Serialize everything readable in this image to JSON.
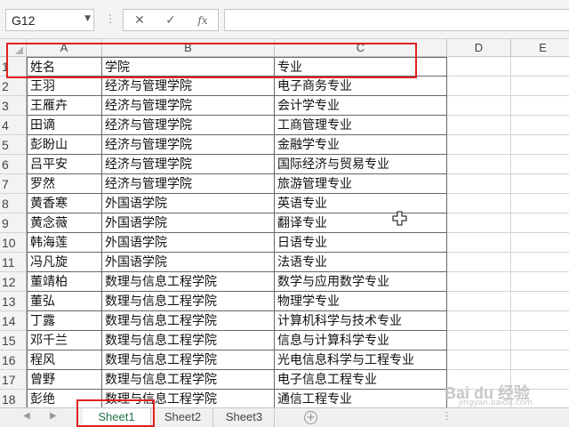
{
  "formula_bar": {
    "name_box": "G12",
    "name_box_arrow_icon": "chevron-down-icon",
    "separator": "⋮",
    "cancel_icon": "close-icon",
    "confirm_icon": "check-icon",
    "function_label": "fx",
    "formula_value": ""
  },
  "columns": [
    "A",
    "B",
    "C",
    "D",
    "E"
  ],
  "rows": [
    {
      "num": "1",
      "cells": [
        "姓名",
        "学院",
        "专业"
      ]
    },
    {
      "num": "2",
      "cells": [
        "王羽",
        "经济与管理学院",
        "电子商务专业"
      ]
    },
    {
      "num": "3",
      "cells": [
        "王雁卉",
        "经济与管理学院",
        "会计学专业"
      ]
    },
    {
      "num": "4",
      "cells": [
        "田谪",
        "经济与管理学院",
        "工商管理专业"
      ]
    },
    {
      "num": "5",
      "cells": [
        "彭盼山",
        "经济与管理学院",
        "金融学专业"
      ]
    },
    {
      "num": "6",
      "cells": [
        "吕平安",
        "经济与管理学院",
        "国际经济与贸易专业"
      ]
    },
    {
      "num": "7",
      "cells": [
        "罗然",
        "经济与管理学院",
        "旅游管理专业"
      ]
    },
    {
      "num": "8",
      "cells": [
        "黄香寒",
        "外国语学院",
        "英语专业"
      ]
    },
    {
      "num": "9",
      "cells": [
        "黄念薇",
        "外国语学院",
        "翻译专业"
      ]
    },
    {
      "num": "10",
      "cells": [
        "韩海莲",
        "外国语学院",
        "日语专业"
      ]
    },
    {
      "num": "11",
      "cells": [
        "冯凡旋",
        "外国语学院",
        "法语专业"
      ]
    },
    {
      "num": "12",
      "cells": [
        "董靖柏",
        "数理与信息工程学院",
        "数学与应用数学专业"
      ]
    },
    {
      "num": "13",
      "cells": [
        "董弘",
        "数理与信息工程学院",
        "物理学专业"
      ]
    },
    {
      "num": "14",
      "cells": [
        "丁露",
        "数理与信息工程学院",
        "计算机科学与技术专业"
      ]
    },
    {
      "num": "15",
      "cells": [
        "邓千兰",
        "数理与信息工程学院",
        "信息与计算科学专业"
      ]
    },
    {
      "num": "16",
      "cells": [
        "程风",
        "数理与信息工程学院",
        "光电信息科学与工程专业"
      ]
    },
    {
      "num": "17",
      "cells": [
        "曾野",
        "数理与信息工程学院",
        "电子信息工程专业"
      ]
    },
    {
      "num": "18",
      "cells": [
        "彭绝",
        "数理与信息工程学院",
        "通信工程专业"
      ]
    }
  ],
  "sheet_tabs": {
    "tabs": [
      "Sheet1",
      "Sheet2",
      "Sheet3"
    ],
    "active": "Sheet1",
    "prev_icon": "◀",
    "next_icon": "▶",
    "add_label": "+",
    "scroll_dots": "⋮"
  },
  "colors": {
    "accent": "#217346",
    "annotation": "#e02020"
  },
  "watermark": {
    "text": "Bai du 经验",
    "sub": "jingyan.baidu.com"
  }
}
